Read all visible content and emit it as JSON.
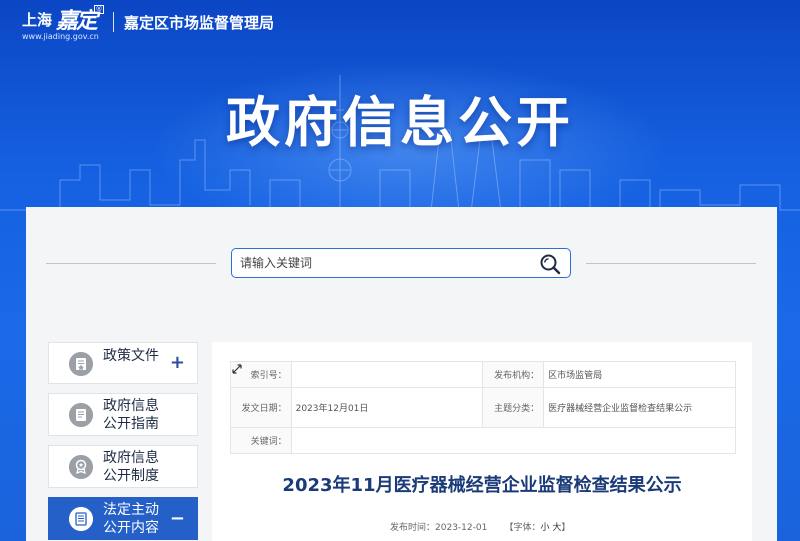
{
  "header": {
    "logo_shanghai": "上海",
    "logo_jiading": "嘉定",
    "logo_reg": "®",
    "logo_url": "www.jiading.gov.cn",
    "org_name": "嘉定区市场监督管理局"
  },
  "hero": {
    "title": "政府信息公开"
  },
  "search": {
    "placeholder": "请输入关键词"
  },
  "sidebar": {
    "items": [
      {
        "label": "政策文件",
        "icon": "document-star-icon",
        "toggle": "+"
      },
      {
        "label": "政府信息\n公开指南",
        "icon": "document-icon"
      },
      {
        "label": "政府信息\n公开制度",
        "icon": "badge-icon"
      },
      {
        "label": "法定主动\n公开内容",
        "icon": "document-list-icon",
        "toggle": "−",
        "active": true
      }
    ]
  },
  "meta": {
    "index_label": "索引号：",
    "index_value": "",
    "publisher_label": "发布机构：",
    "publisher_value": "区市场监管局",
    "date_label": "发文日期：",
    "date_value": "2023年12月01日",
    "category_label": "主题分类：",
    "category_value": "医疗器械经营企业监督检查结果公示",
    "keywords_label": "关键词：",
    "keywords_value": ""
  },
  "article": {
    "title": "2023年11月医疗器械经营企业监督检查结果公示",
    "publish_time_label": "发布时间：",
    "publish_time": "2023-12-01",
    "font_label": "【字体：",
    "font_small": "小",
    "font_large": "大",
    "font_close": "】"
  },
  "colors": {
    "primary_blue": "#2560c8",
    "title_blue": "#1b3a78",
    "hero_blue": "#1560e0"
  }
}
